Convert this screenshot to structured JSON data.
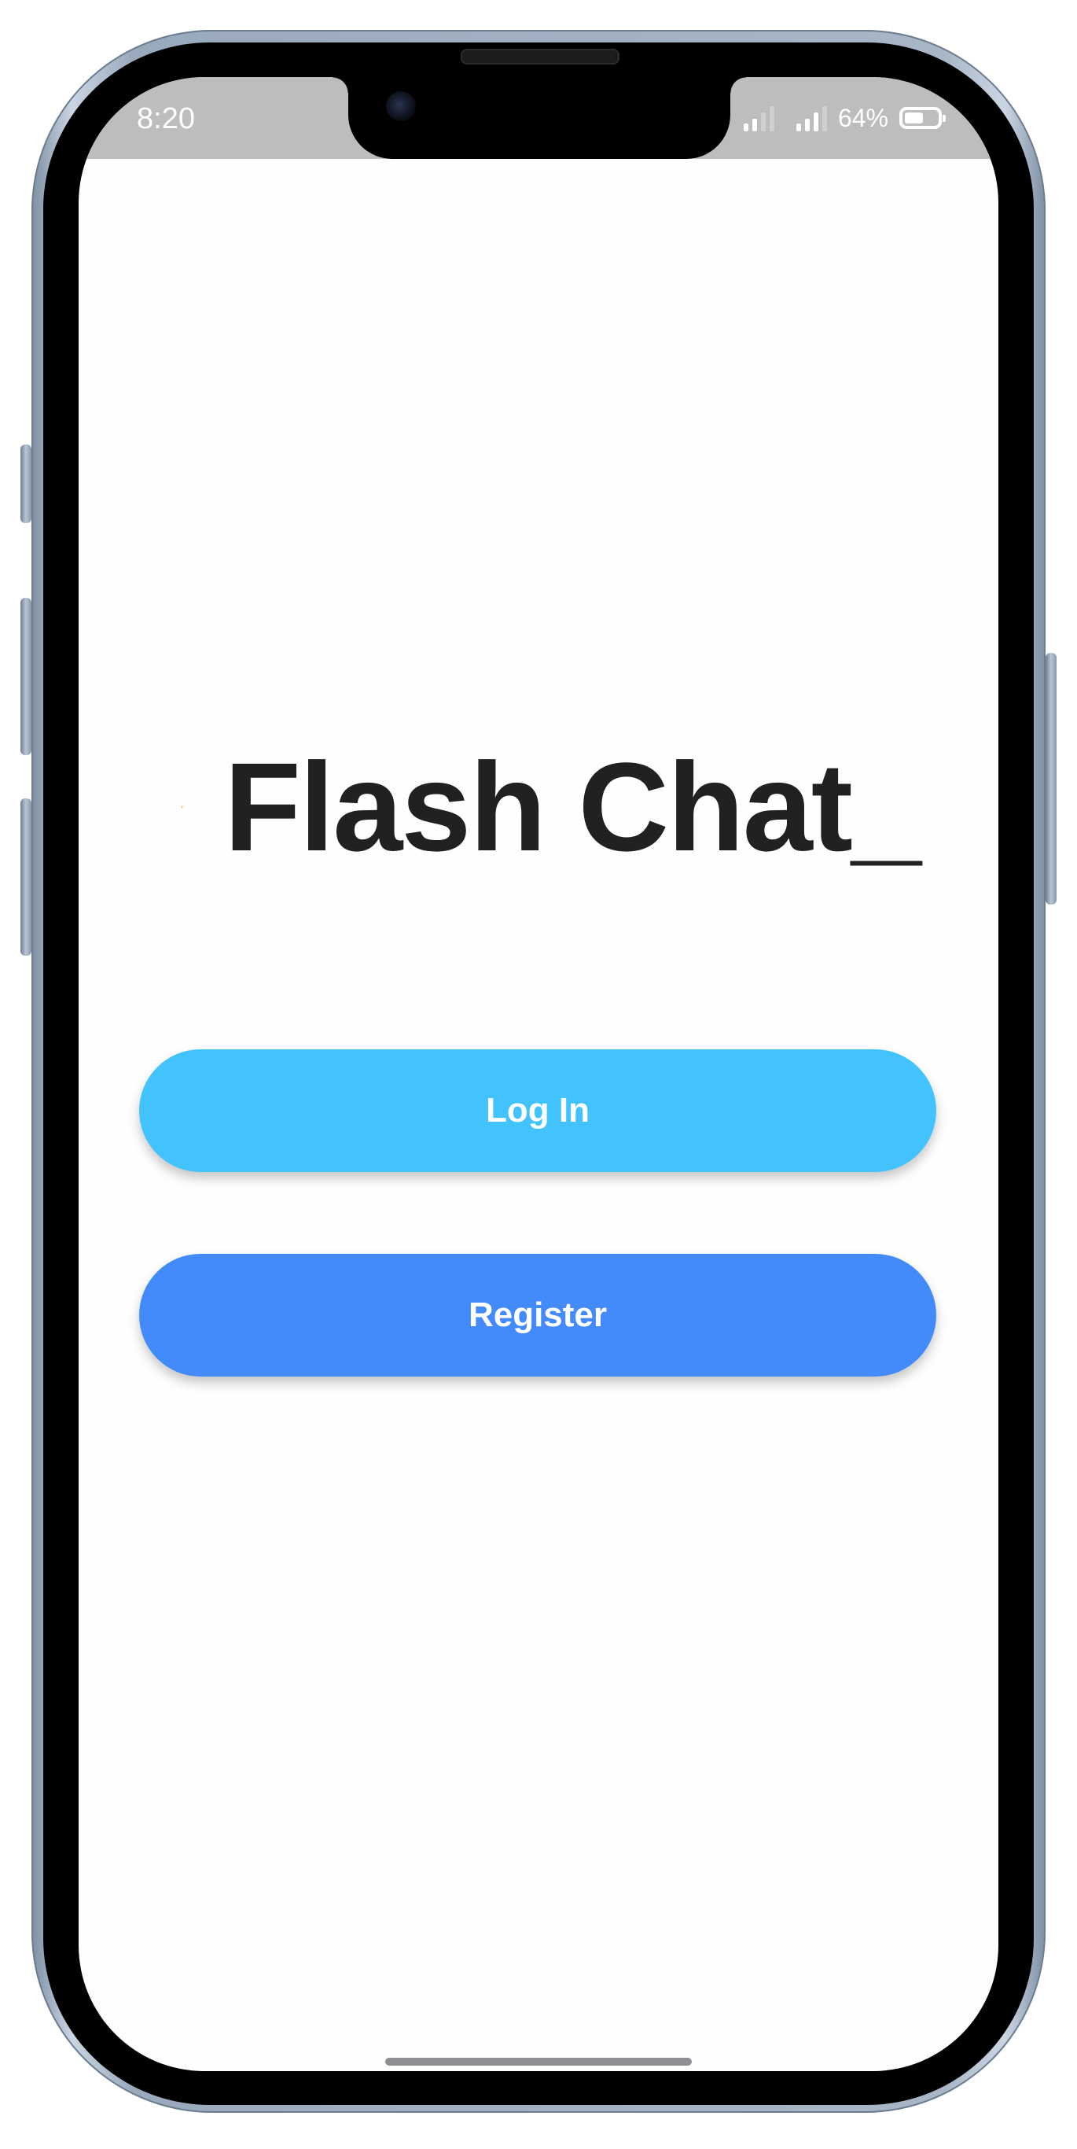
{
  "status_bar": {
    "time": "8:20",
    "battery_percent": "64%",
    "battery_level": 0.64
  },
  "app": {
    "title": "Flash Chat_",
    "logo_icon": "lightning-bolt-icon",
    "accent_color": "#FBBC16"
  },
  "buttons": {
    "login_label": "Log In",
    "login_color": "#42C3FD",
    "register_label": "Register",
    "register_color": "#438AFB"
  }
}
